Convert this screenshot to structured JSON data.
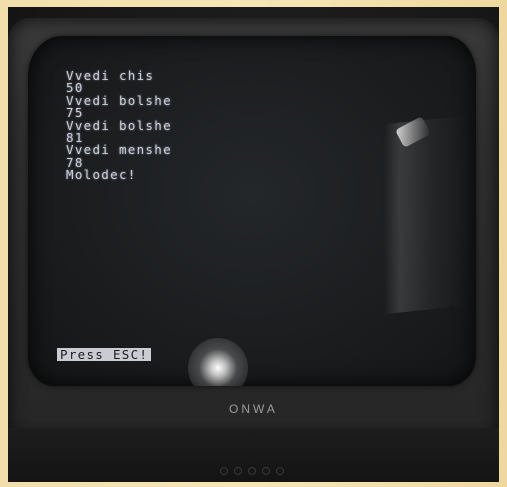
{
  "screen": {
    "lines": [
      "Vvedi chis",
      "50",
      "Vvedi bolshe",
      "75",
      "Vvedi bolshe",
      "81",
      "Vvedi menshe",
      "78",
      "Molodec!"
    ],
    "prompt": "Press ESC!",
    "text_color": "#c9d0dc",
    "prompt_background": "#c9ccd2"
  },
  "monitor": {
    "brand": "ONWA"
  }
}
